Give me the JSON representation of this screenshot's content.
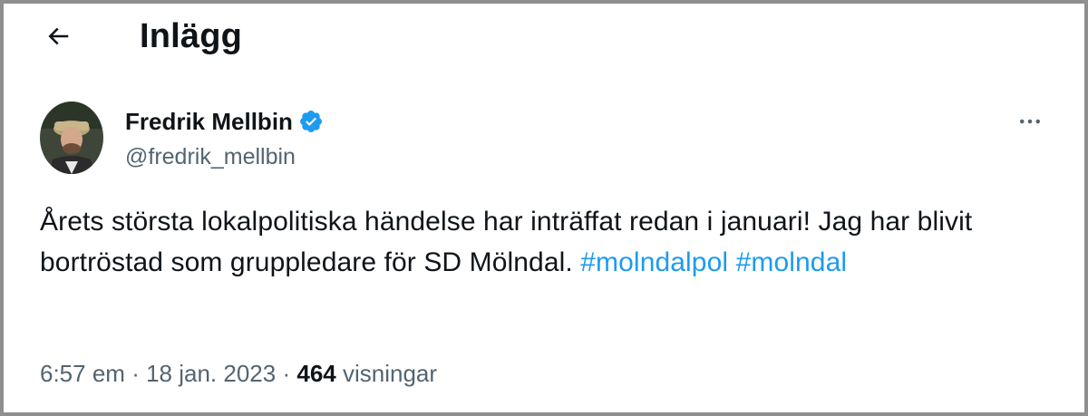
{
  "header": {
    "title": "Inlägg",
    "back_icon": "arrow-left-icon"
  },
  "author": {
    "name": "Fredrik Mellbin",
    "handle": "@fredrik_mellbin",
    "verified": true,
    "verified_color": "#1d9bf0"
  },
  "post": {
    "text_before_tags": "Årets största lokalpolitiska händelse har inträffat redan i januari! Jag har blivit bortröstad som gruppledare för SD Mölndal.",
    "hashtags": [
      "#molndalpol",
      "#molndal"
    ],
    "link_color": "#1d9bf0"
  },
  "meta": {
    "time": "6:57 em",
    "separator": "·",
    "date": "18 jan. 2023",
    "views_count": "464",
    "views_label": "visningar"
  },
  "more_menu_icon": "more-horizontal-icon"
}
